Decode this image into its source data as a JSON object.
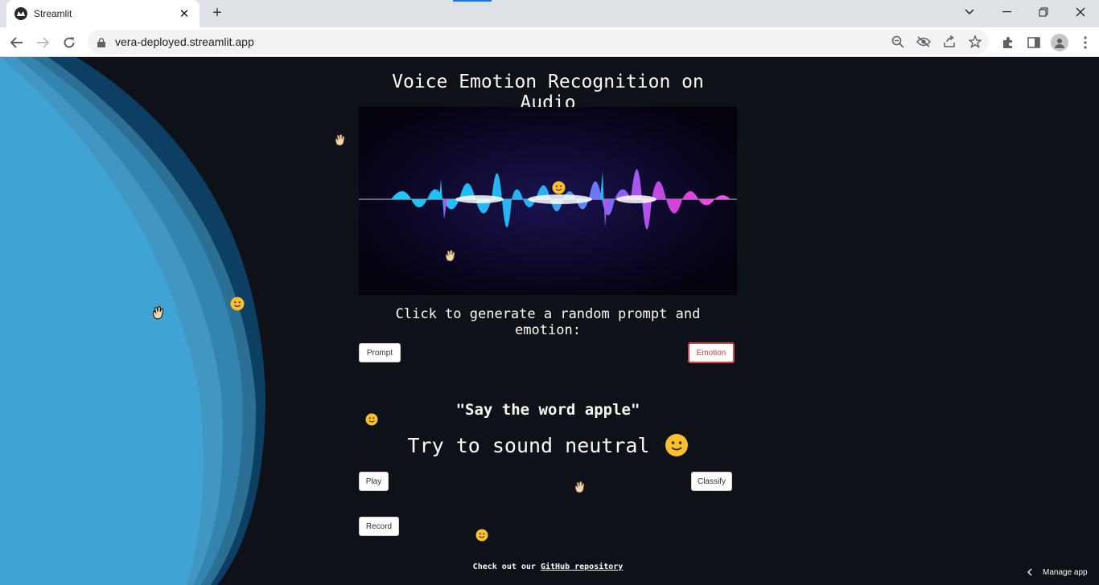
{
  "browser": {
    "tab_title": "Streamlit",
    "url": "vera-deployed.streamlit.app",
    "new_tab": "+",
    "close_tab": "✕"
  },
  "app": {
    "title": "Voice Emotion Recognition on Audio",
    "instruction": "Click to generate a random prompt and emotion:",
    "prompt_button": "Prompt",
    "emotion_button": "Emotion",
    "prompt_text": "\"Say the word apple\"",
    "emotion_text": "Try to sound neutral",
    "play_button": "Play",
    "classify_button": "Classify",
    "record_button": "Record",
    "footer_prefix": "Check out our ",
    "footer_link": "GitHub repository",
    "manage_app": "Manage app"
  },
  "colors": {
    "app_bg": "#0e1117",
    "accent_blue": "#3fa4d4",
    "emotion_border": "#d64545"
  }
}
